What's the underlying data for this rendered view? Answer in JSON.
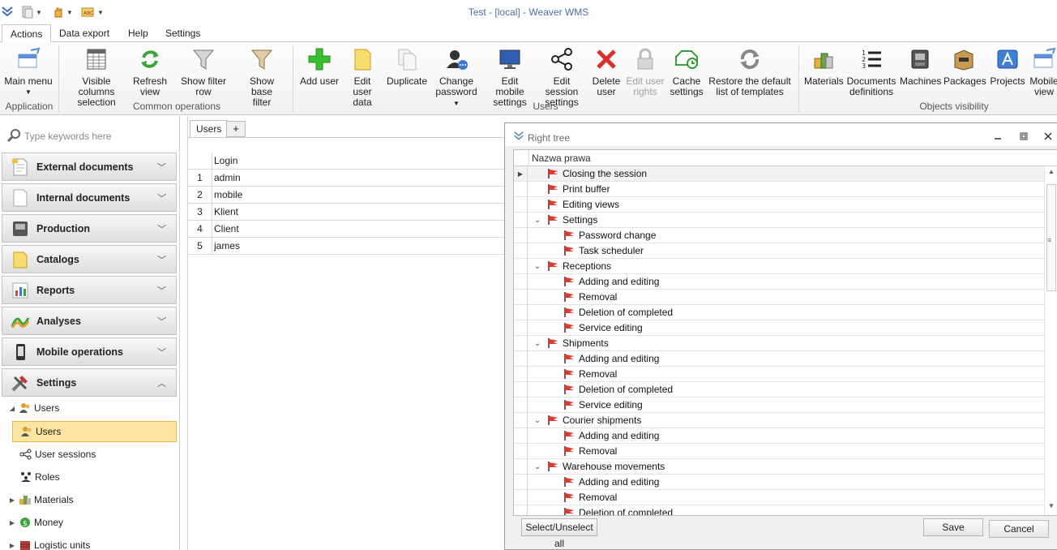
{
  "window": {
    "title": "Test - [local] - Weaver WMS"
  },
  "ribbon_tabs": [
    "Actions",
    "Data export",
    "Help",
    "Settings"
  ],
  "ribbon": {
    "application": {
      "group_label": "Application",
      "main_menu": "Main menu"
    },
    "common": {
      "group_label": "Common operations",
      "visible_columns_1": "Visible columns",
      "visible_columns_2": "selection",
      "refresh_1": "Refresh",
      "refresh_2": "view",
      "show_filter_row": "Show filter row",
      "show_base_1": "Show base",
      "show_base_2": "filter"
    },
    "users": {
      "group_label": "Users",
      "add_user": "Add user",
      "edit_user_1": "Edit user",
      "edit_user_2": "data",
      "duplicate": "Duplicate",
      "change_password_1": "Change",
      "change_password_2": "password",
      "edit_mobile_1": "Edit mobile",
      "edit_mobile_2": "settings",
      "edit_session_1": "Edit session",
      "edit_session_2": "settings",
      "delete_1": "Delete",
      "delete_2": "user",
      "edit_rights_1": "Edit user",
      "edit_rights_2": "rights",
      "cache_1": "Cache",
      "cache_2": "settings",
      "restore_1": "Restore the default",
      "restore_2": "list of templates"
    },
    "objects": {
      "group_label": "Objects visibility",
      "materials": "Materials",
      "documents_1": "Documents",
      "documents_2": "definitions",
      "machines": "Machines",
      "packages": "Packages",
      "projects": "Projects",
      "mobile_1": "Mobile",
      "mobile_2": "view"
    }
  },
  "left_nav": {
    "search_placeholder": "Type keywords here",
    "sections": [
      "External documents",
      "Internal documents",
      "Production",
      "Catalogs",
      "Reports",
      "Analyses",
      "Mobile operations",
      "Settings"
    ],
    "tree": [
      "Users",
      "Users",
      "User sessions",
      "Roles",
      "Materials",
      "Money",
      "Logistic units"
    ]
  },
  "middle": {
    "tab_label": "Users",
    "add_tab": "+",
    "column_header": "Login",
    "rows": [
      {
        "num": "1",
        "login": "admin"
      },
      {
        "num": "2",
        "login": "mobile"
      },
      {
        "num": "3",
        "login": "Klient"
      },
      {
        "num": "4",
        "login": "Client"
      },
      {
        "num": "5",
        "login": "james"
      }
    ]
  },
  "dialog": {
    "title": "Right tree",
    "column_header": "Nazwa prawa",
    "rows": [
      {
        "label": "Closing the session",
        "level": 0,
        "expander": ""
      },
      {
        "label": "Print buffer",
        "level": 0,
        "expander": ""
      },
      {
        "label": "Editing views",
        "level": 0,
        "expander": ""
      },
      {
        "label": "Settings",
        "level": 0,
        "expander": "v"
      },
      {
        "label": "Password change",
        "level": 1,
        "expander": ""
      },
      {
        "label": "Task scheduler",
        "level": 1,
        "expander": ""
      },
      {
        "label": "Receptions",
        "level": 0,
        "expander": "v"
      },
      {
        "label": "Adding and editing",
        "level": 1,
        "expander": ""
      },
      {
        "label": "Removal",
        "level": 1,
        "expander": ""
      },
      {
        "label": "Deletion of completed",
        "level": 1,
        "expander": ""
      },
      {
        "label": "Service editing",
        "level": 1,
        "expander": ""
      },
      {
        "label": "Shipments",
        "level": 0,
        "expander": "v"
      },
      {
        "label": "Adding and editing",
        "level": 1,
        "expander": ""
      },
      {
        "label": "Removal",
        "level": 1,
        "expander": ""
      },
      {
        "label": "Deletion of completed",
        "level": 1,
        "expander": ""
      },
      {
        "label": "Service editing",
        "level": 1,
        "expander": ""
      },
      {
        "label": "Courier shipments",
        "level": 0,
        "expander": "v"
      },
      {
        "label": "Adding and editing",
        "level": 1,
        "expander": ""
      },
      {
        "label": "Removal",
        "level": 1,
        "expander": ""
      },
      {
        "label": "Warehouse movements",
        "level": 0,
        "expander": "v"
      },
      {
        "label": "Adding and editing",
        "level": 1,
        "expander": ""
      },
      {
        "label": "Removal",
        "level": 1,
        "expander": ""
      },
      {
        "label": "Deletion of completed",
        "level": 1,
        "expander": ""
      }
    ],
    "select_all": "Select/Unselect all",
    "save": "Save",
    "cancel": "Cancel"
  }
}
